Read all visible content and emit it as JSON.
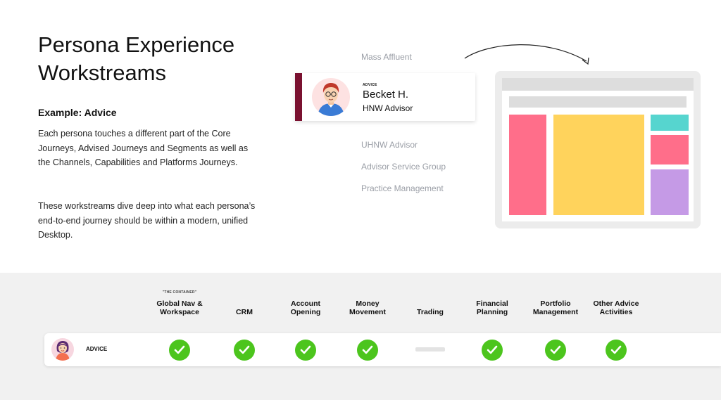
{
  "header": {
    "title": "Persona Experience Workstreams",
    "example_heading": "Example: Advice",
    "paragraph1": "Each persona touches a different part of the Core Journeys, Advised Journeys and Segments as well as the Channels, Capabilities and Platforms Journeys.",
    "paragraph2": "These workstreams dive deep into what each persona’s end-to-end journey should be within a modern, unified Desktop."
  },
  "personas": {
    "mass_affluent": "Mass Affluent",
    "uhnw": "UHNW Advisor",
    "service_group": "Advisor Service Group",
    "practice": "Practice Management"
  },
  "persona_card": {
    "tag": "ADVICE",
    "name": "Becket H.",
    "role": "HNW Advisor",
    "accent_color": "#7a1130"
  },
  "desktop_mock": {
    "colors": [
      "#ff6e8a",
      "#ffd35c",
      "#56d5cf",
      "#c59ae6"
    ]
  },
  "workstream_table": {
    "container_tag": "\"THE CONTAINER\"",
    "columns": [
      {
        "label": "Global Nav & Workspace",
        "status": "check"
      },
      {
        "label": "CRM",
        "status": "check"
      },
      {
        "label": "Account Opening",
        "status": "check"
      },
      {
        "label": "Money Movement",
        "status": "check"
      },
      {
        "label": "Trading",
        "status": "none"
      },
      {
        "label": "Financial Planning",
        "status": "check"
      },
      {
        "label": "Portfolio Management",
        "status": "check"
      },
      {
        "label": "Other Advice Activities",
        "status": "check"
      }
    ],
    "row_label": "ADVICE",
    "check_color": "#4cc51d"
  }
}
